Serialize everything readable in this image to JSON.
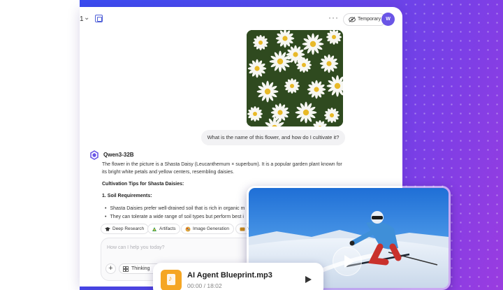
{
  "topbar": {
    "conversation_number": "1",
    "more_label": "···",
    "temporary_label": "Temporary",
    "avatar_initial": "W"
  },
  "chat": {
    "user_message": "What is the name of this flower, and how do I cultivate it?",
    "model_name": "Qwen3-32B",
    "answer_paragraph": "The flower in the picture is a Shasta Daisy (Leucanthemum × superbum). It is a popular garden plant known for its bright white petals and yellow centers, resembling daisies.",
    "tips_heading": "Cultivation Tips for Shasta Daisies:",
    "soil_heading": "1. Soil Requirements:",
    "bullets": [
      "Shasta Daisies prefer well-drained soil that is rich in organic m",
      "They can tolerate a wide range of soil types but perform best i"
    ]
  },
  "tools": [
    {
      "label": "Deep Research",
      "icon": "graduation-cap-icon"
    },
    {
      "label": "Artifacts",
      "icon": "artifacts-icon"
    },
    {
      "label": "Image Generation",
      "icon": "image-generation-icon"
    },
    {
      "label": "Vi",
      "icon": "video-icon"
    }
  ],
  "input": {
    "placeholder": "How can I help you today?",
    "plus_label": "+",
    "thinking_label": "Thinking"
  },
  "audio": {
    "file_name": "AI Agent Blueprint.mp3",
    "time": "00:00 / 18:02"
  },
  "colors": {
    "accent": "#6a55e6",
    "backdrop_start": "#3a4cf0",
    "backdrop_end": "#9a3ce0",
    "audio_icon": "#f5a623"
  }
}
